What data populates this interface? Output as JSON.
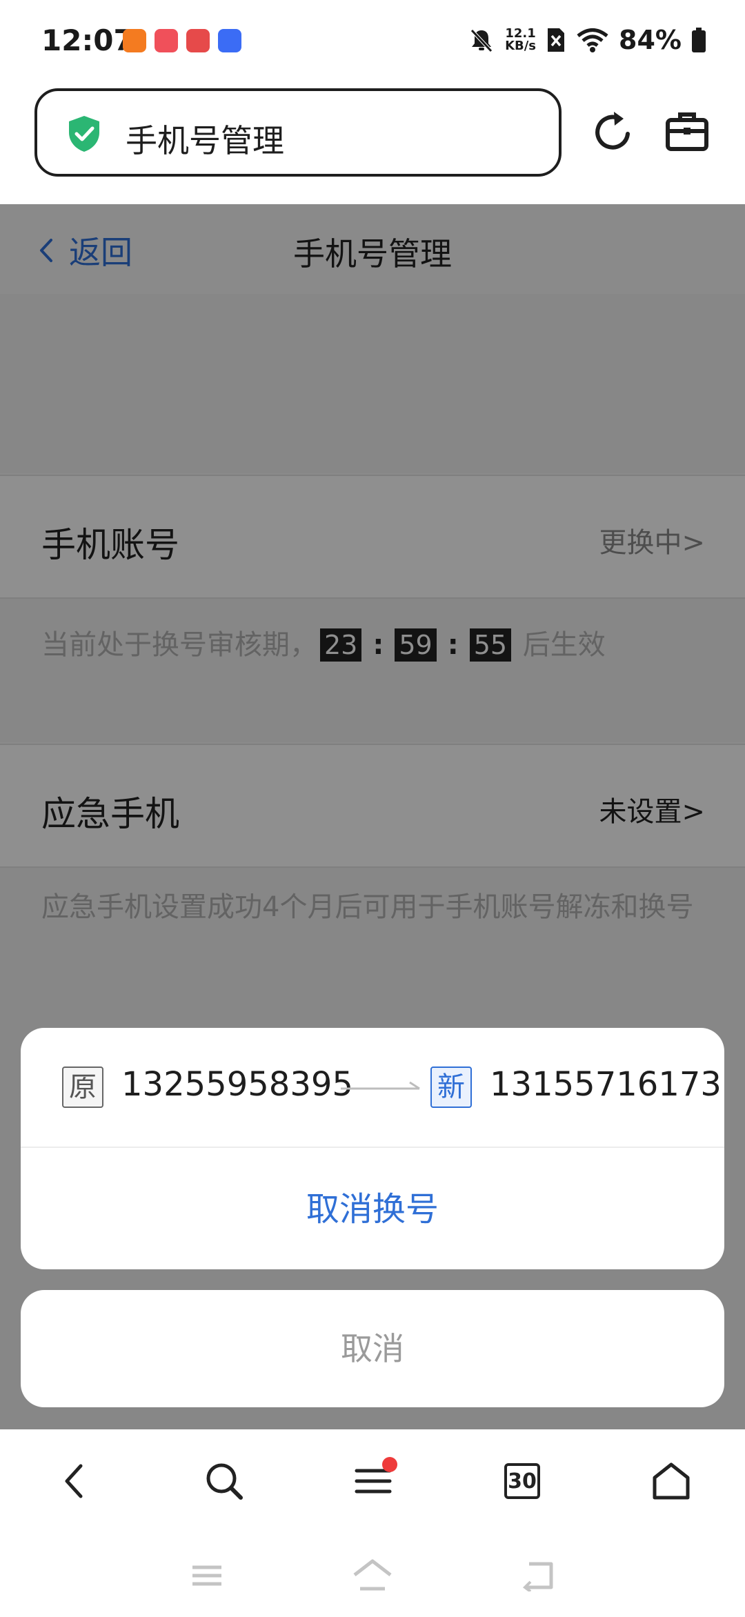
{
  "status_bar": {
    "time": "12:07",
    "net_speed_value": "12.1",
    "net_speed_unit": "KB/s",
    "battery": "84%",
    "app_icon_colors": [
      "#f47b20",
      "#f0505a",
      "#e64a4a",
      "#3b6cf5"
    ]
  },
  "address_bar": {
    "title": "手机号管理",
    "shield_color": "#2bb673"
  },
  "page": {
    "back_label": "返回",
    "title": "手机号管理",
    "phone_account": {
      "label": "手机账号",
      "value": "更换中>"
    },
    "review_notice": {
      "prefix": "当前处于换号审核期，",
      "hours": "23",
      "minutes": "59",
      "seconds": "55",
      "suffix": "后生效"
    },
    "emergency_phone": {
      "label": "应急手机",
      "value": "未设置>"
    },
    "emergency_hint": "应急手机设置成功4个月后可用于手机账号解冻和换号"
  },
  "action_sheet": {
    "old_tag": "原",
    "old_number": "13255958395",
    "new_tag": "新",
    "new_number": "13155716173",
    "cancel_change_label": "取消换号",
    "cancel_label": "取消"
  },
  "toolbar": {
    "tab_count": "30"
  },
  "colors": {
    "accent": "#2f6fd6",
    "badge": "#ee3b3b"
  }
}
